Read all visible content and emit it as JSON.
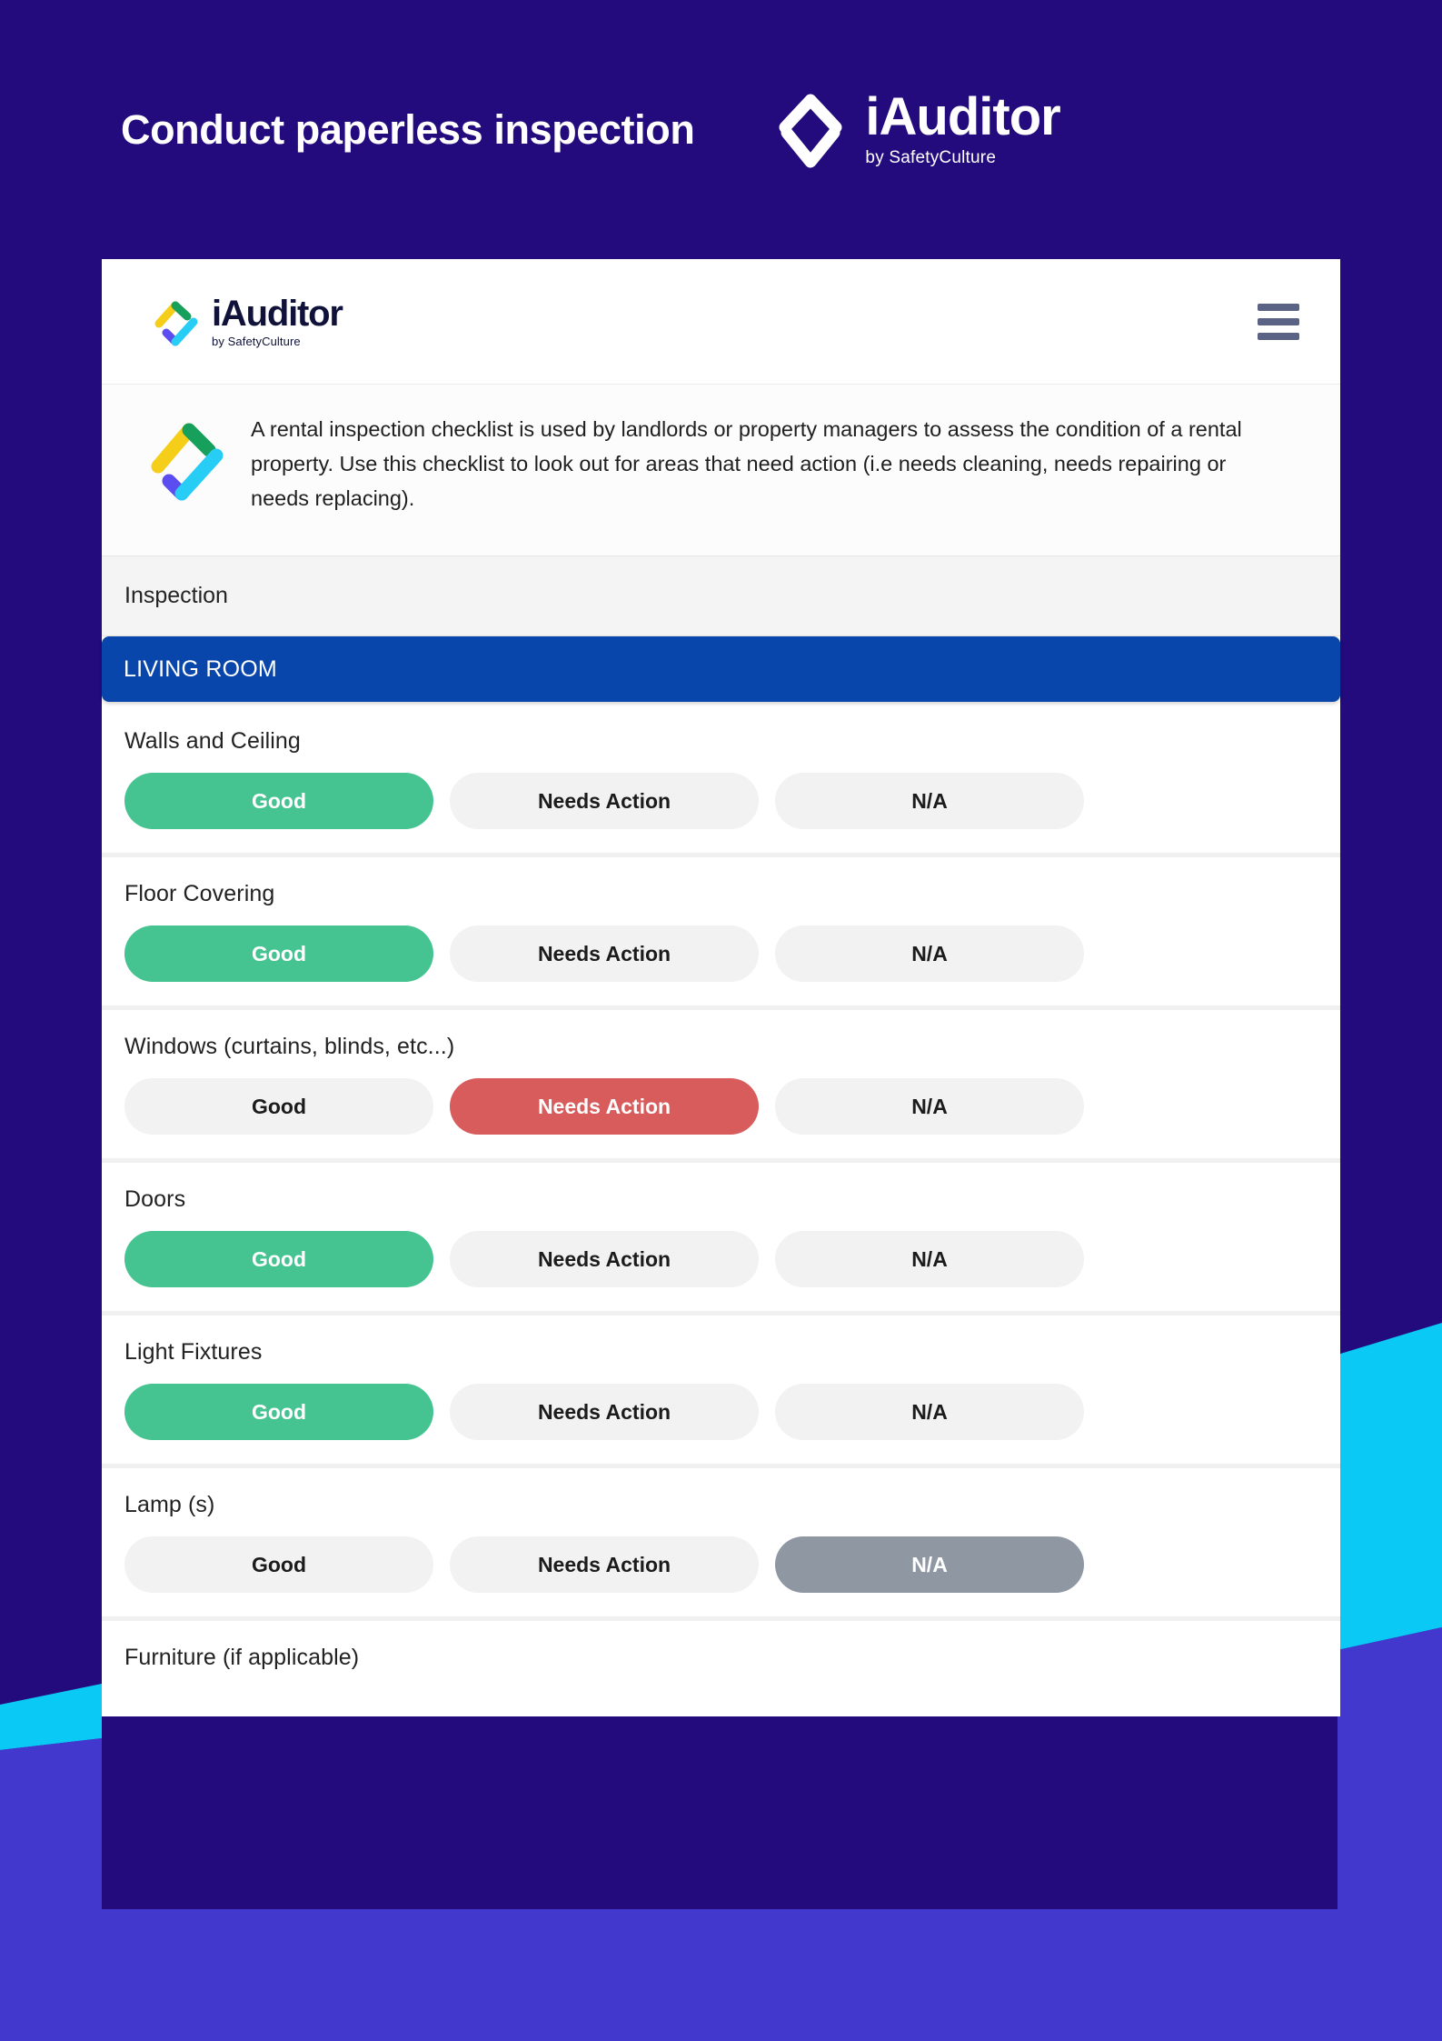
{
  "hero": {
    "title": "Conduct paperless inspection",
    "logo": {
      "wordmark": "iAuditor",
      "subwordmark": "by SafetyCulture",
      "mark_icon": "iauditor-chevron-check-icon"
    }
  },
  "app": {
    "logo": {
      "wordmark": "iAuditor",
      "subwordmark": "by SafetyCulture",
      "mark_icon": "iauditor-chevron-check-icon"
    },
    "menu_icon": "hamburger-menu-icon",
    "description": {
      "mark_icon": "iauditor-chevron-check-icon",
      "text": "A rental inspection checklist is used by landlords or property managers to assess the condition of a rental property. Use this checklist to look out for areas that need action (i.e needs cleaning, needs repairing or needs replacing)."
    },
    "section_title": "Inspection",
    "room_title": "LIVING ROOM",
    "options": [
      "Good",
      "Needs Action",
      "N/A"
    ],
    "questions": [
      {
        "label": "Walls and Ceiling",
        "selected": "Good"
      },
      {
        "label": "Floor Covering",
        "selected": "Good"
      },
      {
        "label": "Windows (curtains, blinds, etc...)",
        "selected": "Needs Action"
      },
      {
        "label": "Doors",
        "selected": "Good"
      },
      {
        "label": "Light Fixtures",
        "selected": "Good"
      },
      {
        "label": "Lamp (s)",
        "selected": "N/A"
      },
      {
        "label": "Furniture (if applicable)",
        "selected": null
      }
    ]
  },
  "colors": {
    "background_deep_purple": "#230a7d",
    "background_blue": "#4338ce",
    "background_cyan": "#0ac9f5",
    "accent_blue_band": "#0846ab",
    "selected_good": "#45c391",
    "selected_needs_action": "#d85c5c",
    "selected_na": "#8f97a3",
    "button_idle": "#f2f2f2",
    "logo_yellow": "#f5ce1a",
    "logo_green": "#17a05c",
    "logo_cyan": "#27cdf5",
    "logo_violet": "#5b4df0"
  }
}
